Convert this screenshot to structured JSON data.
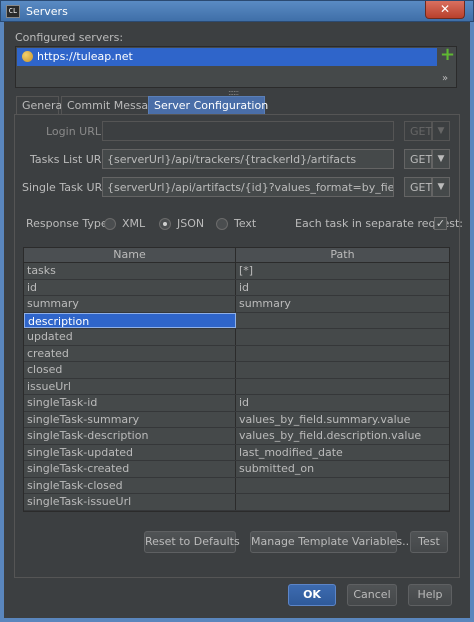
{
  "window": {
    "title": "Servers",
    "app_icon": "CL",
    "close_glyph": "✕"
  },
  "configured_servers": {
    "label": "Configured servers:",
    "servers": [
      "https://tuleap.net"
    ],
    "add_glyph": "+",
    "more_glyph": "»",
    "splitter_glyph": "::::::"
  },
  "tabs": [
    "General",
    "Commit Message",
    "Server Configuration"
  ],
  "form": {
    "login_url": {
      "label": "Login URL:",
      "value": "",
      "method": "GET",
      "drop": "▼"
    },
    "tasks_list_url": {
      "label": "Tasks List URL:",
      "value": "{serverUrl}/api/trackers/{trackerId}/artifacts",
      "method": "GET",
      "drop": "▼"
    },
    "single_task_url": {
      "label": "Single Task URL:",
      "value": "{serverUrl}/api/artifacts/{id}?values_format=by_field",
      "method": "GET",
      "drop": "▼"
    },
    "response_type": {
      "label": "Response Type:",
      "options": [
        "XML",
        "JSON",
        "Text"
      ],
      "selected": "JSON"
    },
    "each_task": {
      "label": "Each task in separate request:",
      "checked": true,
      "check_glyph": "✓"
    }
  },
  "table": {
    "headers": [
      "Name",
      "Path"
    ],
    "rows": [
      {
        "name": "tasks",
        "path": "[*]"
      },
      {
        "name": "id",
        "path": "id"
      },
      {
        "name": "summary",
        "path": "summary"
      },
      {
        "name": "description",
        "path": ""
      },
      {
        "name": "updated",
        "path": ""
      },
      {
        "name": "created",
        "path": ""
      },
      {
        "name": "closed",
        "path": ""
      },
      {
        "name": "issueUrl",
        "path": ""
      },
      {
        "name": "singleTask-id",
        "path": "id"
      },
      {
        "name": "singleTask-summary",
        "path": "values_by_field.summary.value"
      },
      {
        "name": "singleTask-description",
        "path": "values_by_field.description.value"
      },
      {
        "name": "singleTask-updated",
        "path": "last_modified_date"
      },
      {
        "name": "singleTask-created",
        "path": "submitted_on"
      },
      {
        "name": "singleTask-closed",
        "path": ""
      },
      {
        "name": "singleTask-issueUrl",
        "path": ""
      }
    ],
    "selected_row": "description"
  },
  "actions": {
    "reset": "Reset to Defaults",
    "manage": "Manage Template Variables...",
    "test": "Test"
  },
  "dialog_buttons": {
    "ok": "OK",
    "cancel": "Cancel",
    "help": "Help"
  }
}
